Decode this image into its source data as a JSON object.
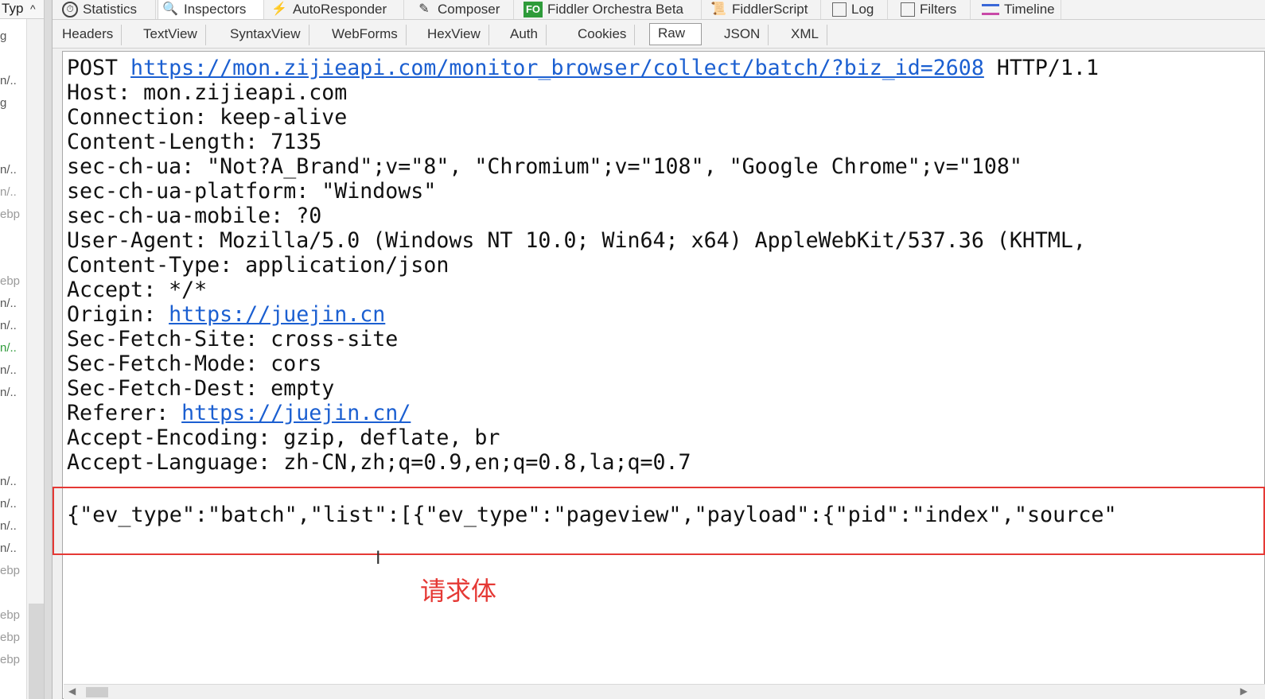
{
  "left_list": {
    "header": "Typ",
    "items": [
      "g",
      "n/..",
      "g",
      "n/..",
      "n/..",
      "ebp",
      "ebp",
      "n/..",
      "n/..",
      "n/..",
      "n/..",
      "n/..",
      "n/..",
      "n/..",
      "n/..",
      "n/..",
      "ebp",
      "ebp",
      "ebp",
      "ebp"
    ]
  },
  "top_tabs": [
    {
      "label": "Statistics",
      "icon": "stopwatch-icon"
    },
    {
      "label": "Inspectors",
      "icon": "magnifier-icon"
    },
    {
      "label": "AutoResponder",
      "icon": "lightning-icon"
    },
    {
      "label": "Composer",
      "icon": "pencil-icon"
    },
    {
      "label": "Fiddler Orchestra Beta",
      "icon": "fo-icon",
      "icon_text": "FO"
    },
    {
      "label": "FiddlerScript",
      "icon": "script-icon"
    },
    {
      "label": "Log",
      "icon": "log-icon"
    },
    {
      "label": "Filters",
      "icon": "checkbox-icon"
    },
    {
      "label": "Timeline",
      "icon": "timeline-icon"
    }
  ],
  "sub_tabs": [
    "Headers",
    "TextView",
    "SyntaxView",
    "WebForms",
    "HexView",
    "Auth",
    "Cookies",
    "Raw",
    "JSON",
    "XML"
  ],
  "active_sub_tab": "Raw",
  "raw": {
    "request_method": "POST ",
    "request_url": "https://mon.zijieapi.com/monitor_browser/collect/batch/?biz_id=2608",
    "request_version": " HTTP/1.1",
    "host": "Host: mon.zijieapi.com",
    "connection": "Connection: keep-alive",
    "content_length": "Content-Length: 7135",
    "sec_ch_ua": "sec-ch-ua: \"Not?A_Brand\";v=\"8\", \"Chromium\";v=\"108\", \"Google Chrome\";v=\"108\"",
    "sec_ch_ua_platform": "sec-ch-ua-platform: \"Windows\"",
    "sec_ch_ua_mobile": "sec-ch-ua-mobile: ?0",
    "user_agent": "User-Agent: Mozilla/5.0 (Windows NT 10.0; Win64; x64) AppleWebKit/537.36 (KHTML, ",
    "content_type": "Content-Type: application/json",
    "accept": "Accept: */*",
    "origin_label": "Origin: ",
    "origin_url": "https://juejin.cn",
    "sec_fetch_site": "Sec-Fetch-Site: cross-site",
    "sec_fetch_mode": "Sec-Fetch-Mode: cors",
    "sec_fetch_dest": "Sec-Fetch-Dest: empty",
    "referer_label": "Referer: ",
    "referer_url": "https://juejin.cn/",
    "accept_encoding": "Accept-Encoding: gzip, deflate, br",
    "accept_language": "Accept-Language: zh-CN,zh;q=0.9,en;q=0.8,la;q=0.7",
    "body": "{\"ev_type\":\"batch\",\"list\":[{\"ev_type\":\"pageview\",\"payload\":{\"pid\":\"index\",\"source\""
  },
  "annotation": "请求体",
  "colors": {
    "highlight": "#e53935",
    "link": "#1b5fd1"
  }
}
